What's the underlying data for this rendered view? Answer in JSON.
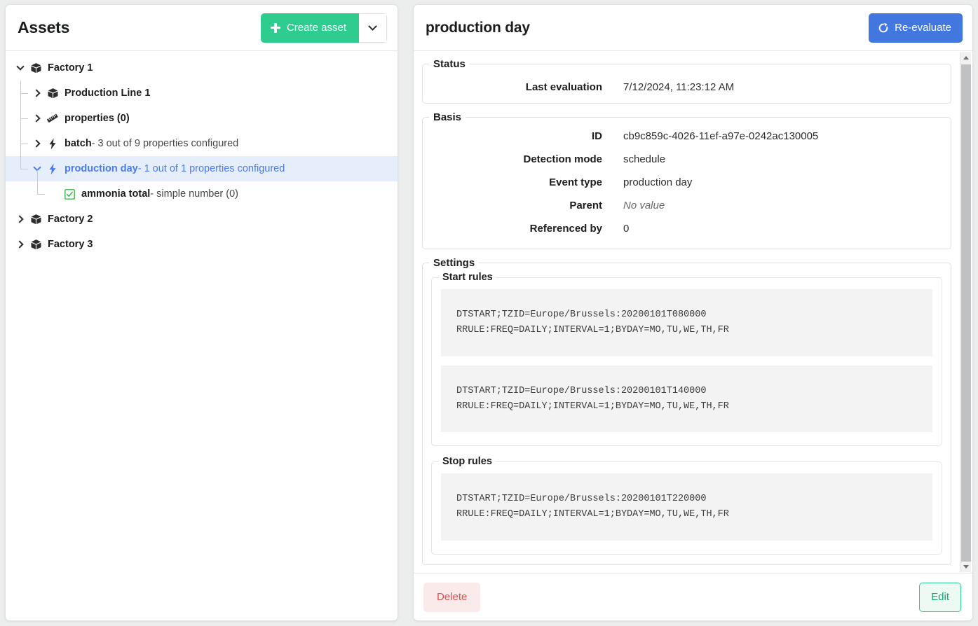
{
  "assets_panel": {
    "title": "Assets",
    "create_button": {
      "label": "Create asset",
      "icon": "plus-icon",
      "color": "#2ecc8f"
    },
    "dropdown_icon": "chevron-down-icon",
    "tree": [
      {
        "label": "Factory 1",
        "suffix": "",
        "icon": "cube-icon",
        "expanded": true,
        "depth": 0,
        "selected": false,
        "toggle": "chevron-down-icon"
      },
      {
        "label": "Production Line 1",
        "suffix": "",
        "icon": "cube-icon",
        "expanded": false,
        "depth": 1,
        "selected": false,
        "toggle": "chevron-right-icon"
      },
      {
        "label": "properties (0)",
        "suffix": "",
        "icon": "ruler-icon",
        "expanded": false,
        "depth": 1,
        "selected": false,
        "toggle": "chevron-right-icon"
      },
      {
        "label": "batch",
        "suffix": " - 3 out of 9 properties configured",
        "icon": "bolt-icon",
        "expanded": false,
        "depth": 1,
        "selected": false,
        "toggle": "chevron-right-icon"
      },
      {
        "label": "production day",
        "suffix": " - 1 out of 1 properties configured",
        "icon": "bolt-icon",
        "expanded": true,
        "depth": 1,
        "selected": true,
        "toggle": "chevron-down-icon"
      },
      {
        "label": "ammonia total",
        "suffix": " - simple number (0)",
        "icon": "checkbox-checked-icon",
        "expanded": false,
        "depth": 2,
        "selected": false,
        "toggle": "none"
      },
      {
        "label": "Factory 2",
        "suffix": "",
        "icon": "cube-icon",
        "expanded": false,
        "depth": 0,
        "selected": false,
        "toggle": "chevron-right-icon"
      },
      {
        "label": "Factory 3",
        "suffix": "",
        "icon": "cube-icon",
        "expanded": false,
        "depth": 0,
        "selected": false,
        "toggle": "chevron-right-icon"
      }
    ]
  },
  "detail_panel": {
    "title": "production day",
    "reevaluate_button": {
      "label": "Re-evaluate",
      "icon": "refresh-icon",
      "color": "#4277e0"
    },
    "status": {
      "legend": "Status",
      "rows": [
        {
          "label": "Last evaluation",
          "value": "7/12/2024, 11:23:12 AM",
          "muted": false
        }
      ]
    },
    "basis": {
      "legend": "Basis",
      "rows": [
        {
          "label": "ID",
          "value": "cb9c859c-4026-11ef-a97e-0242ac130005",
          "muted": false
        },
        {
          "label": "Detection mode",
          "value": "schedule",
          "muted": false
        },
        {
          "label": "Event type",
          "value": "production day",
          "muted": false
        },
        {
          "label": "Parent",
          "value": "No value",
          "muted": true
        },
        {
          "label": "Referenced by",
          "value": "0",
          "muted": false
        }
      ]
    },
    "settings": {
      "legend": "Settings",
      "start_rules": {
        "legend": "Start rules",
        "rules": [
          "DTSTART;TZID=Europe/Brussels:20200101T080000\nRRULE:FREQ=DAILY;INTERVAL=1;BYDAY=MO,TU,WE,TH,FR",
          "DTSTART;TZID=Europe/Brussels:20200101T140000\nRRULE:FREQ=DAILY;INTERVAL=1;BYDAY=MO,TU,WE,TH,FR"
        ]
      },
      "stop_rules": {
        "legend": "Stop rules",
        "rules": [
          "DTSTART;TZID=Europe/Brussels:20200101T220000\nRRULE:FREQ=DAILY;INTERVAL=1;BYDAY=MO,TU,WE,TH,FR"
        ]
      }
    },
    "footer": {
      "delete_label": "Delete",
      "edit_label": "Edit",
      "delete_color": "#d9534f",
      "edit_color": "#17a673"
    },
    "scrollbar": {
      "up_icon": "triangle-up-icon",
      "down_icon": "triangle-down-icon"
    }
  }
}
